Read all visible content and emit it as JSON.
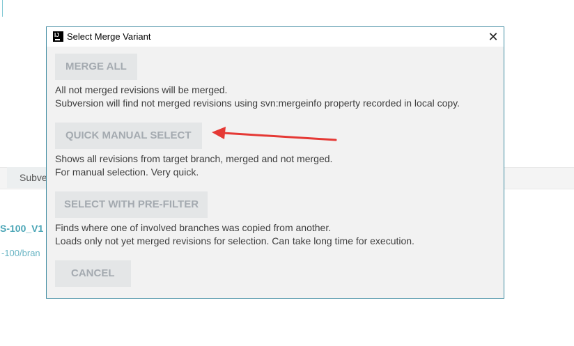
{
  "background": {
    "tab_label": "Subve",
    "branch_label": "S-100_V1",
    "path_label": "-100/bran"
  },
  "dialog": {
    "title": "Select Merge Variant",
    "close_glyph": "✕",
    "app_icon_text": "IJ",
    "options": [
      {
        "button": "MERGE ALL",
        "lines": [
          "All not merged revisions will be merged.",
          "Subversion will find not merged revisions using svn:mergeinfo property recorded in local copy."
        ]
      },
      {
        "button": "QUICK MANUAL SELECT",
        "lines": [
          "Shows all revisions from target branch, merged and not merged.",
          "For manual selection. Very quick."
        ]
      },
      {
        "button": "SELECT WITH PRE-FILTER",
        "lines": [
          "Finds where one of involved branches was copied from another.",
          "Loads only not yet merged revisions for selection. Can take long time for execution."
        ]
      }
    ],
    "cancel": "CANCEL"
  },
  "annotation": {
    "arrow_color": "#e53935"
  },
  "colors": {
    "dialog_border": "#3f8ba1",
    "button_bg": "#e4e6e7",
    "button_text": "#a4aab0"
  }
}
